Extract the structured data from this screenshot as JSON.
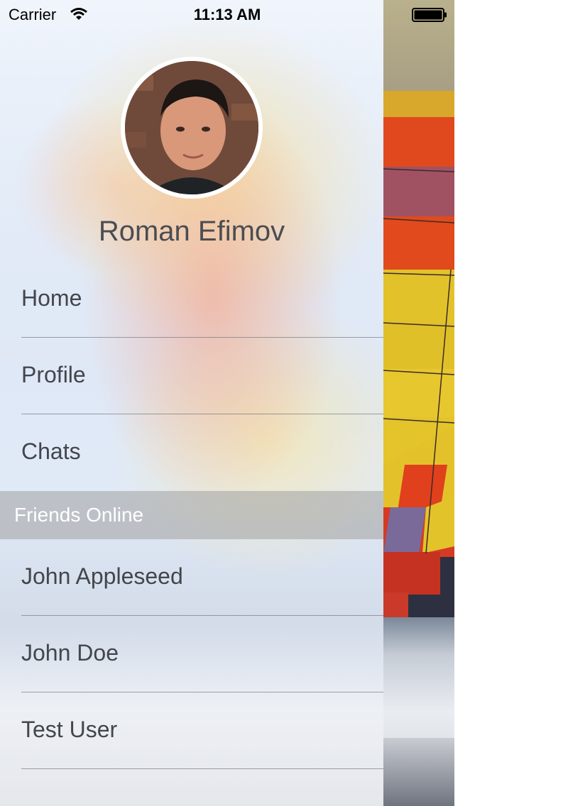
{
  "status_bar": {
    "carrier": "Carrier",
    "time": "11:13 AM",
    "wifi_icon": "wifi-icon",
    "battery_icon": "battery-full-icon"
  },
  "profile": {
    "name": "Roman Efimov",
    "avatar_icon": "avatar"
  },
  "menu": {
    "items": [
      {
        "label": "Home"
      },
      {
        "label": "Profile"
      },
      {
        "label": "Chats"
      }
    ]
  },
  "friends": {
    "header": "Friends Online",
    "items": [
      {
        "label": "John Appleseed"
      },
      {
        "label": "John Doe"
      },
      {
        "label": "Test User"
      }
    ]
  },
  "colors": {
    "text": "#43464b",
    "section_header_bg": "#a0a0a0",
    "divider": "#5a5f69"
  }
}
